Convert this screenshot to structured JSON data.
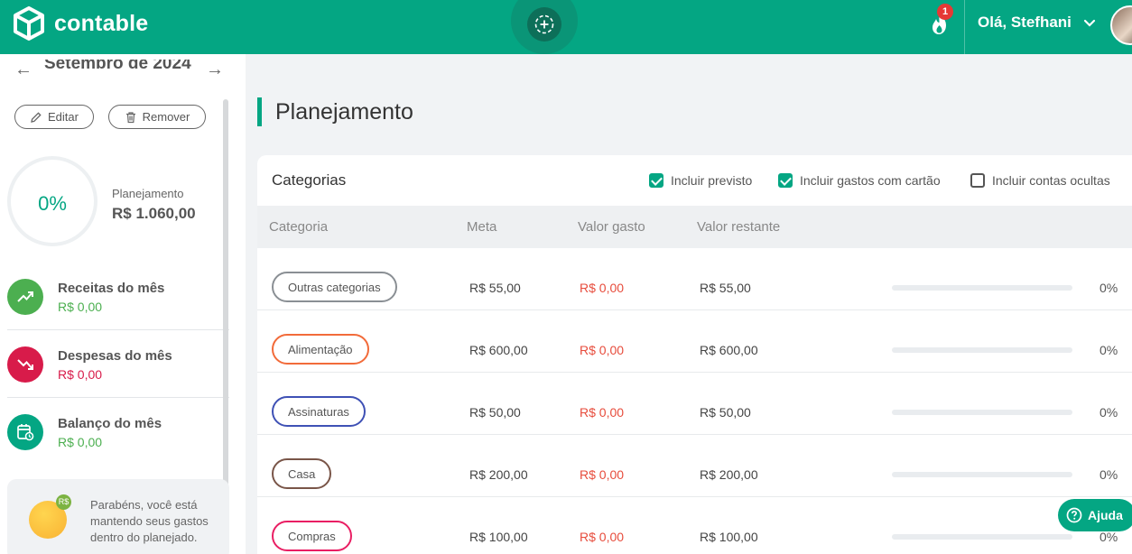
{
  "header": {
    "brand": "contable",
    "notification_count": "1",
    "greeting": "Olá, Stefhani"
  },
  "sidebar": {
    "month": "Setembro de 2024",
    "prev_arrow": "←",
    "next_arrow": "→",
    "edit_label": "Editar",
    "remove_label": "Remover",
    "progress_percent": "0%",
    "planning_label": "Planejamento",
    "planning_value": "R$ 1.060,00",
    "summaries": [
      {
        "title": "Receitas do mês",
        "value": "R$ 0,00",
        "color": "#4caf50",
        "icon": "trending-up-icon"
      },
      {
        "title": "Despesas do mês",
        "value": "R$ 0,00",
        "color": "#d81b4a",
        "icon": "trending-down-icon"
      },
      {
        "title": "Balanço do mês",
        "value": "R$ 0,00",
        "color": "#04a683",
        "icon": "calendar-clock-icon"
      }
    ],
    "tip_text": "Parabéns, você está mantendo seus gastos dentro do planejado.",
    "tip_badge": "R$"
  },
  "main": {
    "page_title": "Planejamento",
    "card_title": "Categorias",
    "filters": [
      {
        "label": "Incluir previsto",
        "checked": true
      },
      {
        "label": "Incluir gastos com cartão",
        "checked": true
      },
      {
        "label": "Incluir contas ocultas",
        "checked": false
      }
    ],
    "columns": [
      "Categoria",
      "Meta",
      "Valor gasto",
      "Valor restante"
    ],
    "rows": [
      {
        "category": "Outras categorias",
        "color": "#8a8f94",
        "goal": "R$ 55,00",
        "spent": "R$ 0,00",
        "remaining": "R$ 55,00",
        "progress": "0%"
      },
      {
        "category": "Alimentação",
        "color": "#f26b3a",
        "goal": "R$ 600,00",
        "spent": "R$ 0,00",
        "remaining": "R$ 600,00",
        "progress": "0%"
      },
      {
        "category": "Assinaturas",
        "color": "#3f51b5",
        "goal": "R$ 50,00",
        "spent": "R$ 0,00",
        "remaining": "R$ 50,00",
        "progress": "0%"
      },
      {
        "category": "Casa",
        "color": "#795548",
        "goal": "R$ 200,00",
        "spent": "R$ 0,00",
        "remaining": "R$ 200,00",
        "progress": "0%"
      },
      {
        "category": "Compras",
        "color": "#e91e63",
        "goal": "R$ 100,00",
        "spent": "R$ 0,00",
        "remaining": "R$ 100,00",
        "progress": "0%"
      }
    ]
  },
  "help_label": "Ajuda",
  "colors": {
    "brand": "#04a683",
    "expense": "#e74c3c"
  }
}
